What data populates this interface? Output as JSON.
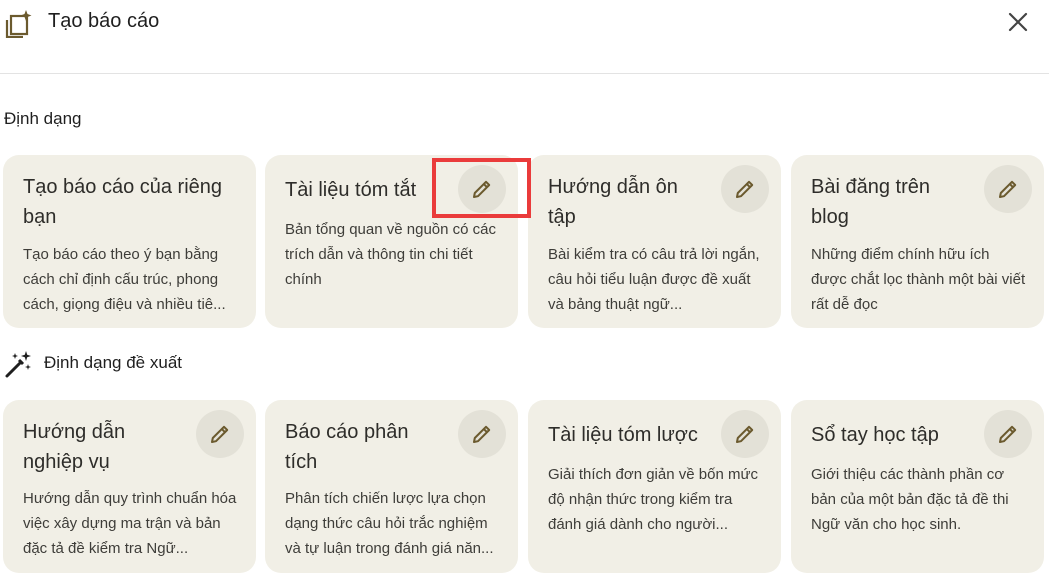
{
  "header": {
    "title": "Tạo báo cáo",
    "icon": "report-sparkle-icon",
    "close_icon": "close-icon"
  },
  "sections": {
    "formats_title": "Định dạng",
    "suggested_title": "Định dạng đề xuất"
  },
  "formats": [
    {
      "title": "Tạo báo cáo của riêng bạn",
      "desc": "Tạo báo cáo theo ý bạn bằng cách chỉ định cấu trúc, phong cách, giọng điệu và nhiều tiê..."
    },
    {
      "title": "Tài liệu tóm tắt",
      "desc": "Bản tổng quan về nguồn có các trích dẫn và thông tin chi tiết chính"
    },
    {
      "title": "Hướng dẫn ôn tập",
      "desc": "Bài kiểm tra có câu trả lời ngắn, câu hỏi tiểu luận được đề xuất và bảng thuật ngữ..."
    },
    {
      "title": "Bài đăng trên blog",
      "desc": "Những điểm chính hữu ích được chắt lọc thành một bài viết rất dễ đọc"
    }
  ],
  "suggested": [
    {
      "title": "Hướng dẫn nghiệp vụ",
      "desc": "Hướng dẫn quy trình chuẩn hóa việc xây dựng ma trận và bản đặc tả đề kiểm tra Ngữ..."
    },
    {
      "title": "Báo cáo phân tích",
      "desc": "Phân tích chiến lược lựa chọn dạng thức câu hỏi trắc nghiệm và tự luận trong đánh giá năn..."
    },
    {
      "title": "Tài liệu tóm lược",
      "desc": "Giải thích đơn giản về bốn mức độ nhận thức trong kiểm tra đánh giá dành cho người..."
    },
    {
      "title": "Sổ tay học tập",
      "desc": "Giới thiệu các thành phần cơ bản của một bản đặc tả đề thi Ngữ văn cho học sinh."
    }
  ],
  "colors": {
    "card_bg": "#f1efe6",
    "edit_bg": "#e3e1d7",
    "icon_brown": "#6b5a2e",
    "highlight": "#ea3b3b"
  }
}
